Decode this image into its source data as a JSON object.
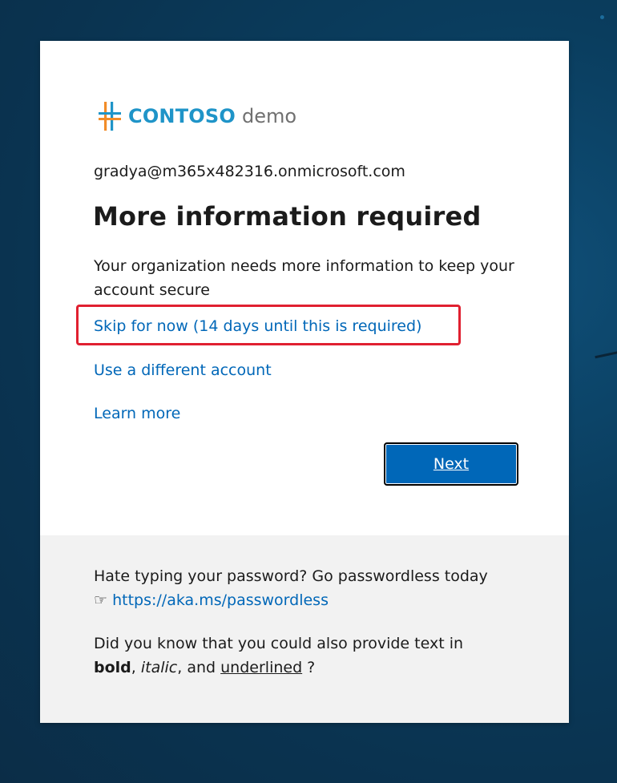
{
  "brand": {
    "name": "CONTOSO",
    "suffix": "demo",
    "colors": {
      "orange": "#f28c28",
      "blue": "#1f94c8",
      "gray": "#707070"
    }
  },
  "account": {
    "email": "gradya@m365x482316.onmicrosoft.com"
  },
  "page": {
    "title": "More information required",
    "description": "Your organization needs more information to keep your account secure"
  },
  "links": {
    "skip": "Skip for now (14 days until this is required)",
    "different_account": "Use a different account",
    "learn_more": "Learn more"
  },
  "actions": {
    "next_label": "Next"
  },
  "footer": {
    "line1": "Hate typing your password? Go passwordless today",
    "pointer_glyph": "☞",
    "passwordless_link": "https://aka.ms/passwordless",
    "line3": "Did you know that you could also provide text in",
    "bold_word": "bold",
    "sep1": ", ",
    "italic_word": "italic",
    "sep2": ", and ",
    "underlined_word": "underlined",
    "end": " ?"
  },
  "highlight": {
    "color": "#e02030",
    "target": "skip-link"
  },
  "theme": {
    "link_color": "#0067b8",
    "button_color": "#0067b8",
    "footer_bg": "#f2f2f2"
  }
}
